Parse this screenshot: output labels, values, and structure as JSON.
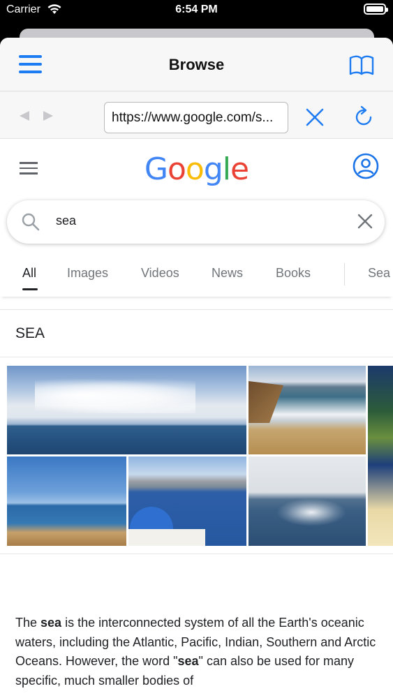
{
  "status_bar": {
    "carrier": "Carrier",
    "time": "6:54 PM"
  },
  "nav": {
    "title": "Browse"
  },
  "url_bar": {
    "url": "https://www.google.com/s..."
  },
  "colors": {
    "accent": "#1e7cf2",
    "google_blue": "#4285f4",
    "google_red": "#ea4335",
    "google_yellow": "#fbbc05",
    "google_green": "#34a853"
  },
  "google": {
    "logo_letters": [
      "G",
      "o",
      "o",
      "g",
      "l",
      "e"
    ],
    "search_query": "sea",
    "tabs": [
      {
        "label": "All",
        "active": true
      },
      {
        "label": "Images",
        "active": false
      },
      {
        "label": "Videos",
        "active": false
      },
      {
        "label": "News",
        "active": false
      },
      {
        "label": "Books",
        "active": false
      },
      {
        "label": "Sea",
        "active": false
      }
    ],
    "topic_title": "SEA",
    "description": {
      "t1": "The ",
      "b1": "sea",
      "t2": " is the interconnected system of all the Earth's oceanic waters, including the Atlantic, Pacific, Indian, Southern and Arctic Oceans. However, the word \"",
      "b2": "sea",
      "t3": "\" can also be used for many specific, much smaller bodies of"
    }
  }
}
